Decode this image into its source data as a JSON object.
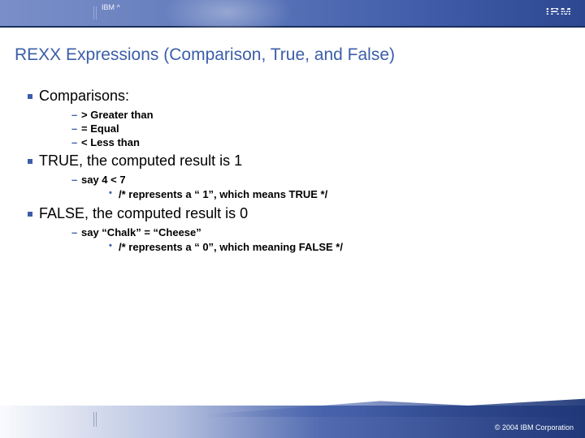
{
  "header": {
    "label": "IBM ^",
    "logo": "IBM"
  },
  "title": "REXX Expressions (Comparison, True, and False)",
  "sections": [
    {
      "heading": "Comparisons:",
      "items": [
        {
          "text": "> Greater than"
        },
        {
          "text": "= Equal"
        },
        {
          "text": "< Less than"
        }
      ]
    },
    {
      "heading": "TRUE, the computed result is 1",
      "items": [
        {
          "text": "say 4 < 7",
          "sub": [
            "/* represents a “ 1”, which means TRUE */"
          ]
        }
      ]
    },
    {
      "heading": "FALSE, the computed result is 0",
      "items": [
        {
          "text": "say “Chalk” = “Cheese”",
          "sub": [
            "/* represents a “ 0”, which meaning FALSE */"
          ]
        }
      ]
    }
  ],
  "footer": {
    "copyright": "© 2004 IBM Corporation"
  }
}
